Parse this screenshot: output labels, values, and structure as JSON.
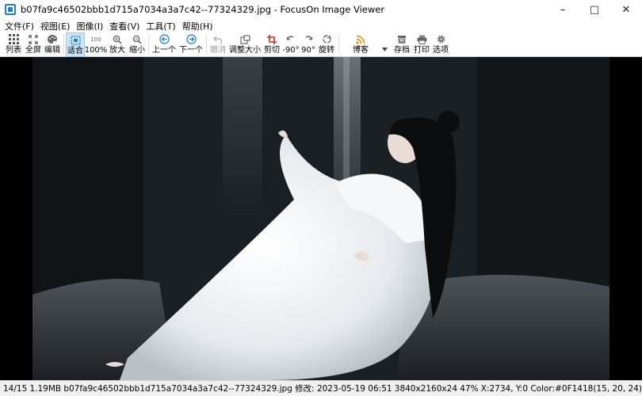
{
  "window": {
    "title": "b07fa9c46502bbb1d715a7034a3a7c42--77324329.jpg - FocusOn Image Viewer",
    "minimize": "–",
    "maximize": "□",
    "close": "✕"
  },
  "menu": [
    {
      "label": "文件(F)"
    },
    {
      "label": "视图(E)"
    },
    {
      "label": "图像(I)"
    },
    {
      "label": "查看(V)"
    },
    {
      "label": "工具(T)"
    },
    {
      "label": "帮助(H)"
    }
  ],
  "toolbar": {
    "list": "列表",
    "fullscreen": "全屏",
    "edit": "编辑",
    "fit": "适合",
    "actual_size": "100%",
    "actual_size_icon_text": "100",
    "zoom_in": "放大",
    "zoom_out": "缩小",
    "prev": "上一个",
    "next": "下一个",
    "undo": "撤消",
    "resize": "调整大小",
    "crop": "剪切",
    "rotate_left": "-90°",
    "rotate_right": "90°",
    "rotate": "旋转",
    "blog": "博客",
    "save": "存档",
    "print": "打印",
    "options": "选项"
  },
  "icons": {
    "list": "grid-icon",
    "fullscreen": "expand-icon",
    "edit": "palette-icon",
    "fit": "fit-icon",
    "zoom_in": "zoom-in-icon",
    "zoom_out": "zoom-out-icon",
    "prev": "arrow-left-circle-icon",
    "next": "arrow-right-circle-icon",
    "undo": "undo-icon",
    "resize": "resize-icon",
    "crop": "crop-icon",
    "rotate_left": "rotate-left-icon",
    "rotate_right": "rotate-right-icon",
    "rotate": "rotate-icon",
    "blog": "rss-icon",
    "save": "archive-icon",
    "print": "printer-icon",
    "options": "gear-icon"
  },
  "colors": {
    "accent_blue": "#1f7fd6",
    "crop_red": "#d9281e",
    "rss_orange": "#f08a00",
    "active_bg": "#cce4f7",
    "viewer_bg": "#000000"
  },
  "status": {
    "position": "14/15",
    "filesize": "1.19MB",
    "filename": "b07fa9c46502bbb1d715a7034a3a7c42--77324329.jpg",
    "modified": "修改: 2023-05-19 06:51",
    "dimensions": "3840x2160x24",
    "zoom": "47%",
    "coords": "X:2734, Y:0",
    "color": "Color:#0F1418(15, 20, 24)"
  }
}
